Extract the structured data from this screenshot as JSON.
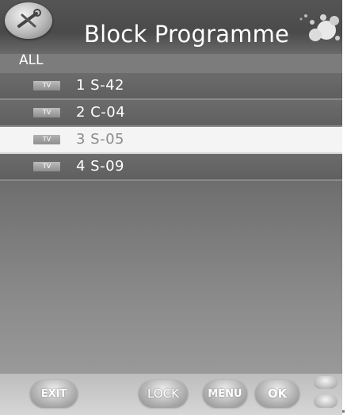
{
  "header": {
    "title": "Block Programme",
    "filter_label": "ALL"
  },
  "channels": [
    {
      "badge": "TV",
      "label": "1 S-42",
      "selected": false
    },
    {
      "badge": "TV",
      "label": "2 C-04",
      "selected": false
    },
    {
      "badge": "TV",
      "label": "3 S-05",
      "selected": true
    },
    {
      "badge": "TV",
      "label": "4 S-09",
      "selected": false
    }
  ],
  "footer": {
    "exit_label": "EXIT",
    "lock_label": "LOCK",
    "menu_label": "MENU",
    "ok_label": "OK"
  },
  "icons": {
    "app": "wrench-screwdriver-icon",
    "decoration": "bubbles-icon"
  },
  "colors": {
    "selected_row": "#f4f4f4",
    "header_bg": "#4a4a4a"
  }
}
